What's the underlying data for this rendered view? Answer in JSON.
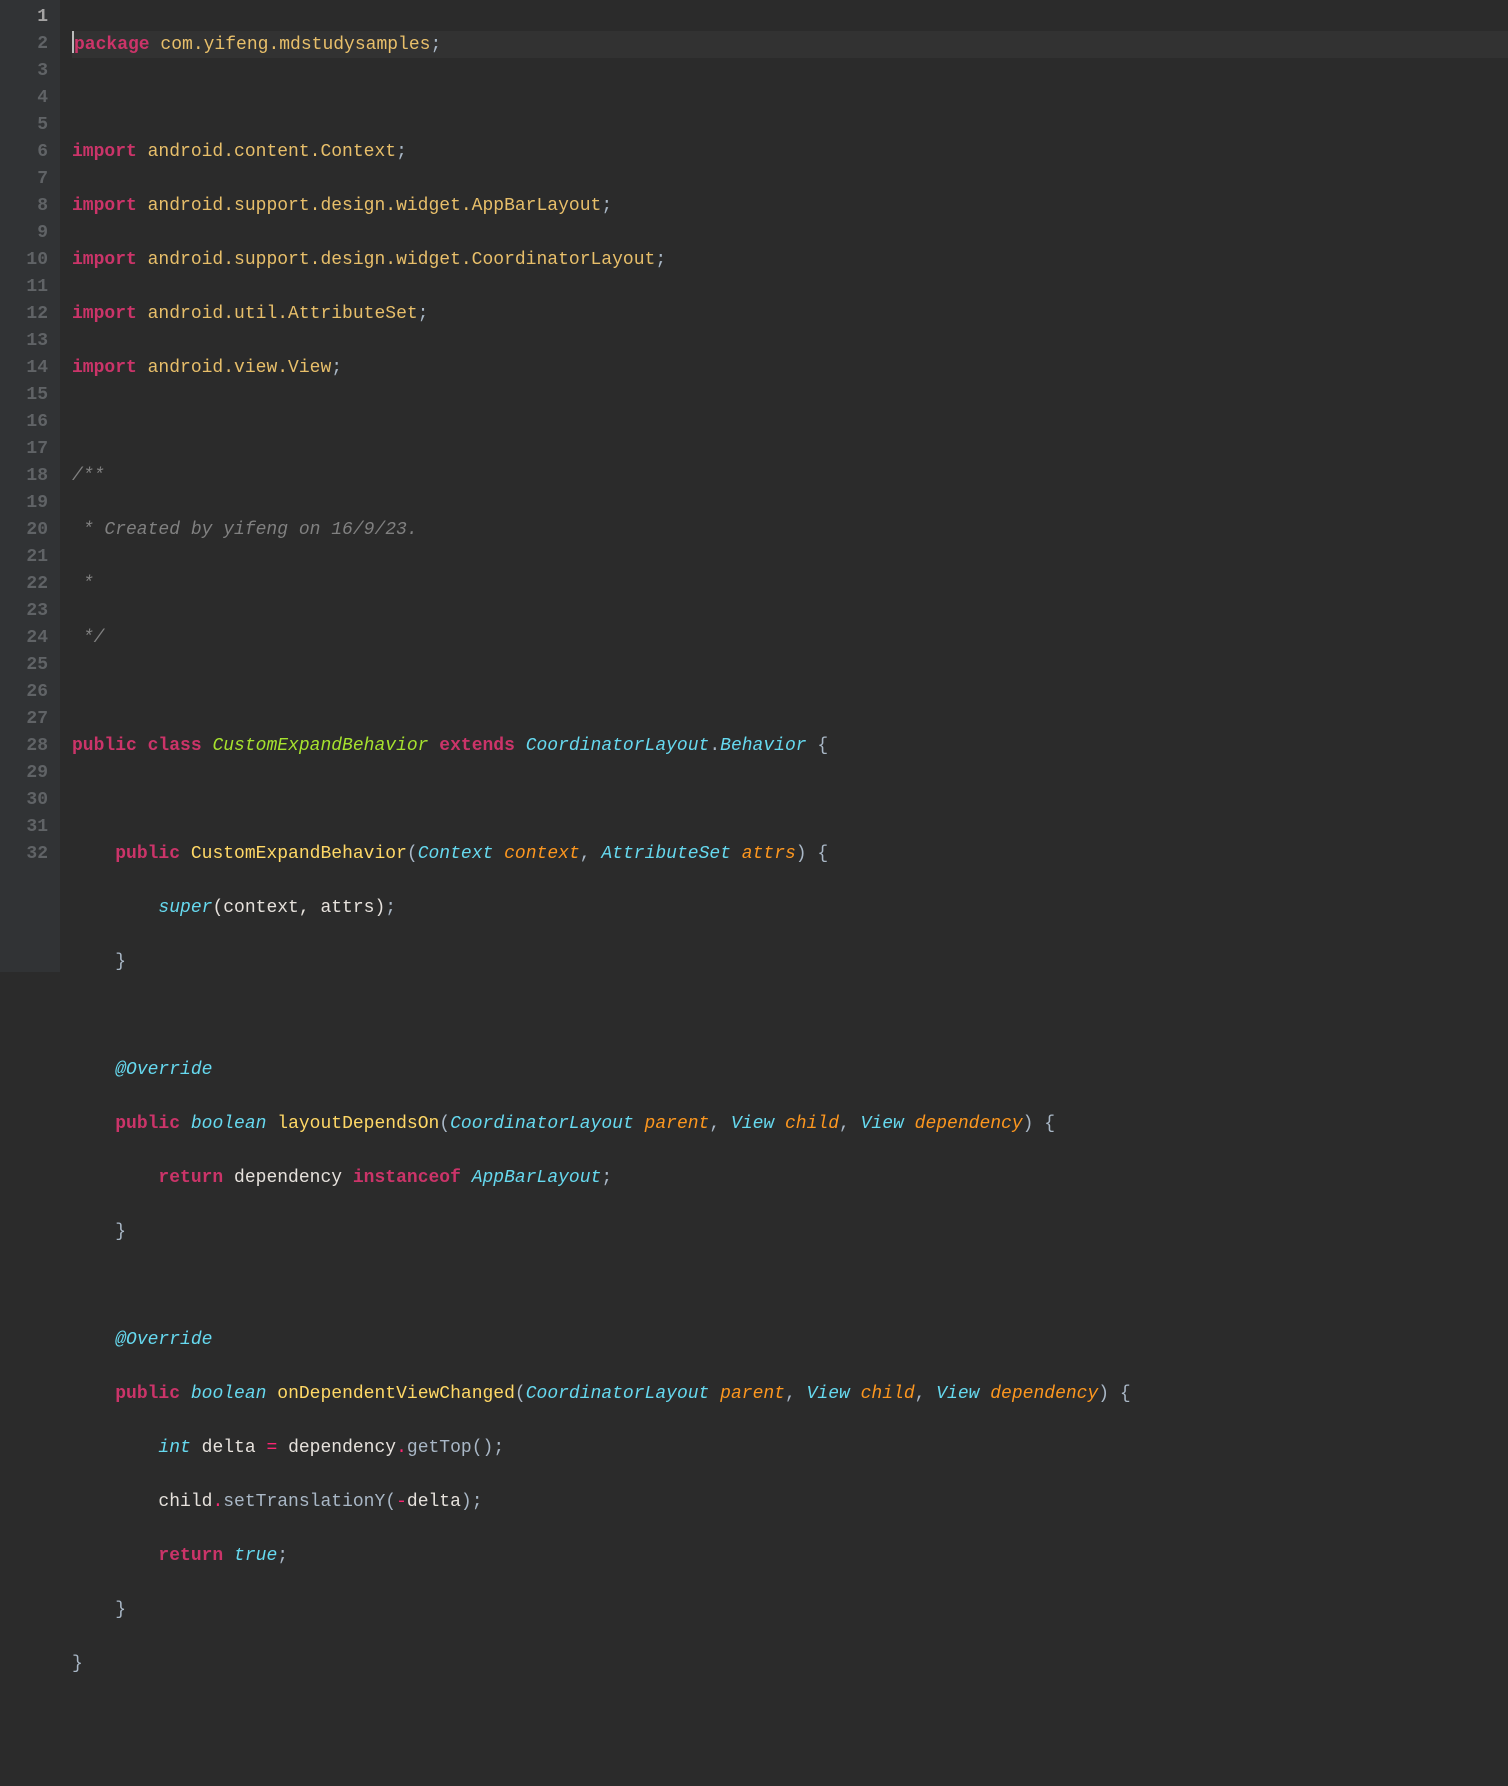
{
  "lines": {
    "ln1": "1",
    "ln2": "2",
    "ln3": "3",
    "ln4": "4",
    "ln5": "5",
    "ln6": "6",
    "ln7": "7",
    "ln8": "8",
    "ln9": "9",
    "ln10": "10",
    "ln11": "11",
    "ln12": "12",
    "ln13": "13",
    "ln14": "14",
    "ln15": "15",
    "ln16": "16",
    "ln17": "17",
    "ln18": "18",
    "ln19": "19",
    "ln20": "20",
    "ln21": "21",
    "ln22": "22",
    "ln23": "23",
    "ln24": "24",
    "ln25": "25",
    "ln26": "26",
    "ln27": "27",
    "ln28": "28",
    "ln29": "29",
    "ln30": "30",
    "ln31": "31",
    "ln32": "32"
  },
  "t": {
    "package": "package ",
    "pkgname": "com.yifeng.mdstudysamples",
    "semi": ";",
    "import": "import ",
    "imp1": "android.content.Context",
    "imp2": "android.support.design.widget.AppBarLayout",
    "imp3": "android.support.design.widget.CoordinatorLayout",
    "imp4": "android.util.AttributeSet",
    "imp5": "android.view.View",
    "cmt1": "/**",
    "cmt2": " * Created by yifeng on 16/9/23.",
    "cmt3": " *",
    "cmt4": " */",
    "public": "public ",
    "class": "class ",
    "clazz": "CustomExpandBehavior",
    "extends": " extends ",
    "coord": "CoordinatorLayout",
    "behavior": "Behavior",
    "lbr": " {",
    "rbr": "}",
    "ctor": "CustomExpandBehavior",
    "lp": "(",
    "rp": ")",
    "context_t": "Context",
    "context_p": " context",
    "comma": ", ",
    "attr_t": "AttributeSet",
    "attr_p": " attrs",
    "super": "super",
    "super_args": "(context, attrs)",
    "override": "@Override",
    "boolean": "boolean ",
    "layoutDependsOn": "layoutDependsOn",
    "parent_t": "CoordinatorLayout",
    "parent_p": " parent",
    "view_t": "View",
    "child_p": " child",
    "dep_p": " dependency",
    "return": "return ",
    "dependency": "dependency",
    "instanceof": " instanceof ",
    "appbar": "AppBarLayout",
    "onDepChanged": "onDependentViewChanged",
    "int": "int ",
    "delta": "delta",
    "eq": " = ",
    "getTop": "getTop",
    "emptyargs": "()",
    "child": "child",
    "setTr": "setTranslationY",
    "neg": "-",
    "true": "true",
    "dot": "."
  }
}
